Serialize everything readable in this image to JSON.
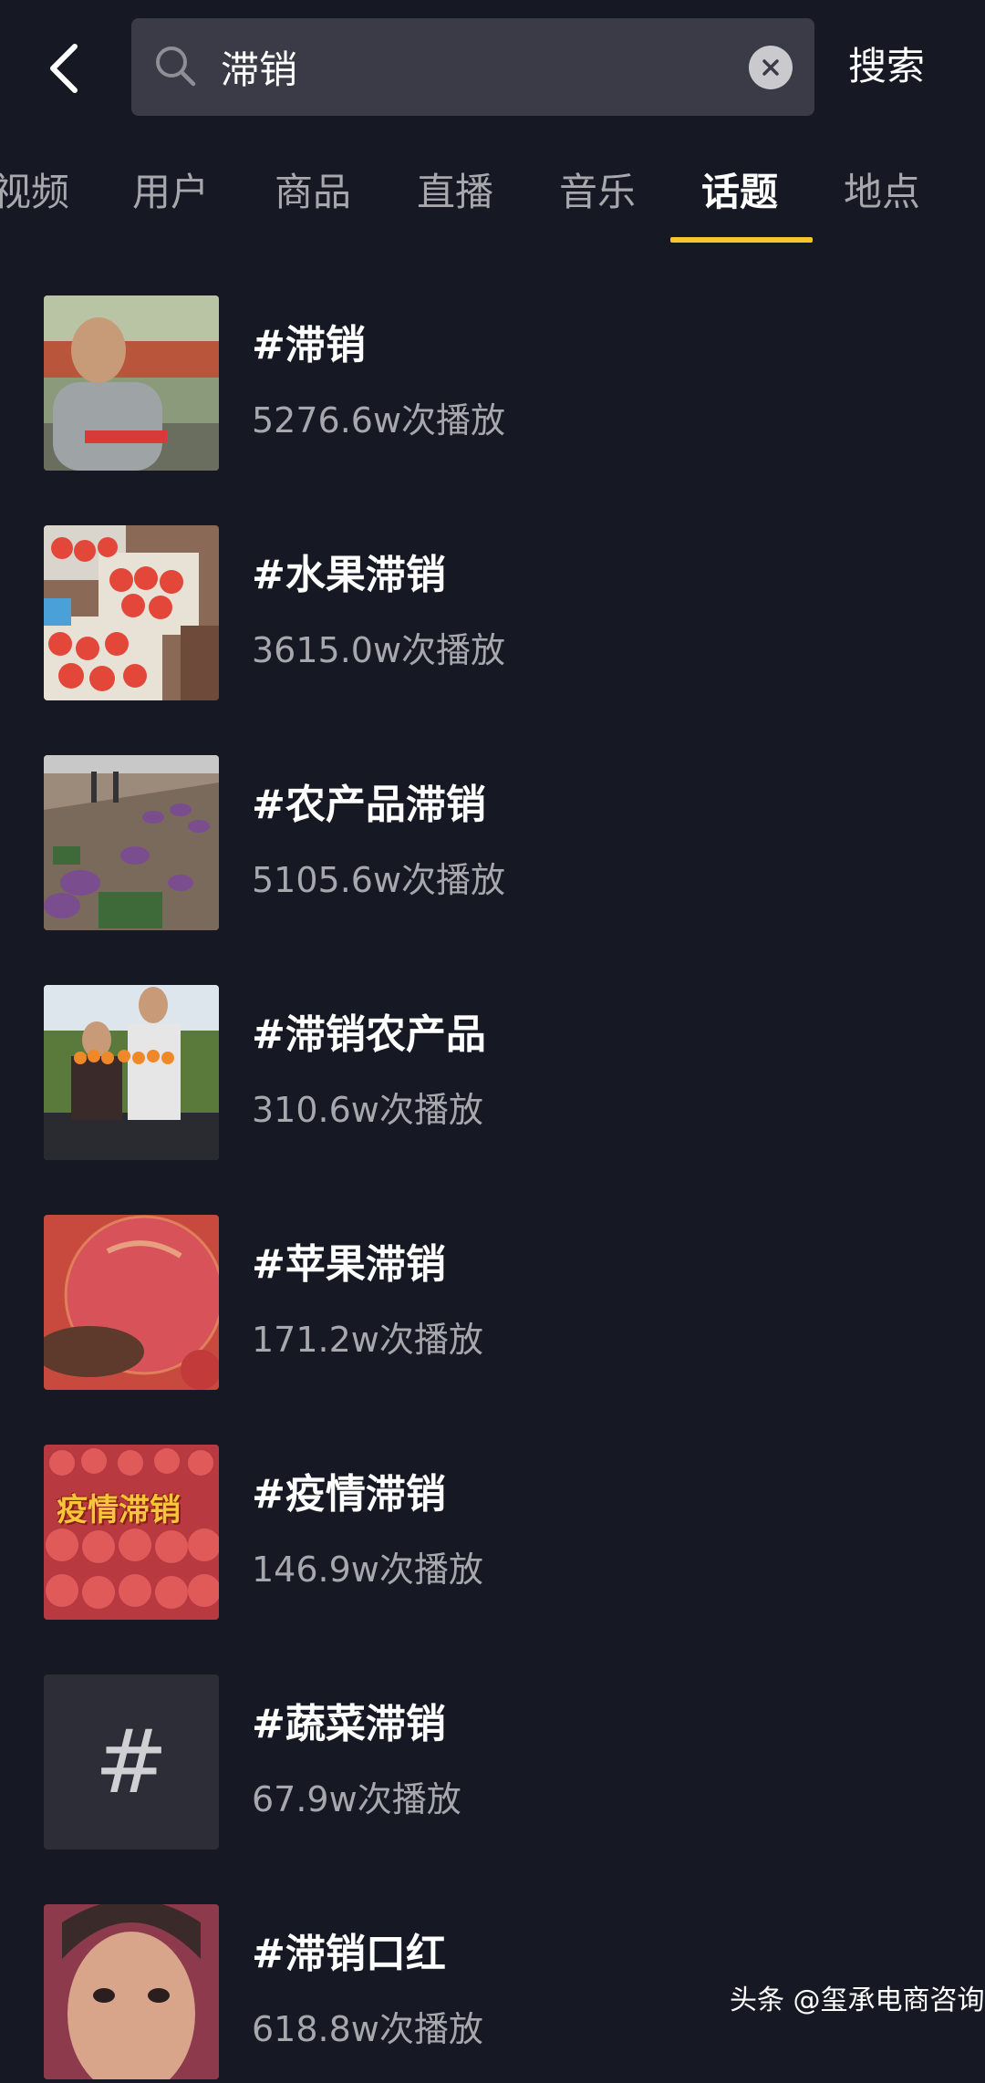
{
  "search": {
    "query": "滞销",
    "submit_label": "搜索",
    "icons": {
      "back": "chevron-left-icon",
      "search": "search-icon",
      "clear": "clear-icon"
    }
  },
  "tabs": [
    {
      "label": "视频",
      "active": false
    },
    {
      "label": "用户",
      "active": false
    },
    {
      "label": "商品",
      "active": false
    },
    {
      "label": "直播",
      "active": false
    },
    {
      "label": "音乐",
      "active": false
    },
    {
      "label": "话题",
      "active": true
    },
    {
      "label": "地点",
      "active": false
    }
  ],
  "topics": [
    {
      "title": "#滞销",
      "plays": "5276.6w次播放",
      "thumb": "farmer-photo"
    },
    {
      "title": "#水果滞销",
      "plays": "3615.0w次播放",
      "thumb": "peaches-crates-photo"
    },
    {
      "title": "#农产品滞销",
      "plays": "5105.6w次播放",
      "thumb": "onion-field-photo"
    },
    {
      "title": "#滞销农产品",
      "plays": "310.6w次播放",
      "thumb": "couple-oranges-photo"
    },
    {
      "title": "#苹果滞销",
      "plays": "171.2w次播放",
      "thumb": "apple-in-hand-photo"
    },
    {
      "title": "#疫情滞销",
      "plays": "146.9w次播放",
      "thumb": "apples-bags-photo",
      "thumb_text": "疫情滞销"
    },
    {
      "title": "#蔬菜滞销",
      "plays": "67.9w次播放",
      "thumb": "hashtag-placeholder-icon",
      "thumb_text": "#"
    },
    {
      "title": "#滞销口红",
      "plays": "618.8w次播放",
      "thumb": "woman-face-photo"
    }
  ],
  "watermark": "头条 @玺承电商咨询",
  "colors": {
    "background": "#161823",
    "accent": "#f7c530",
    "secondary_text": "#a7a8ad"
  }
}
